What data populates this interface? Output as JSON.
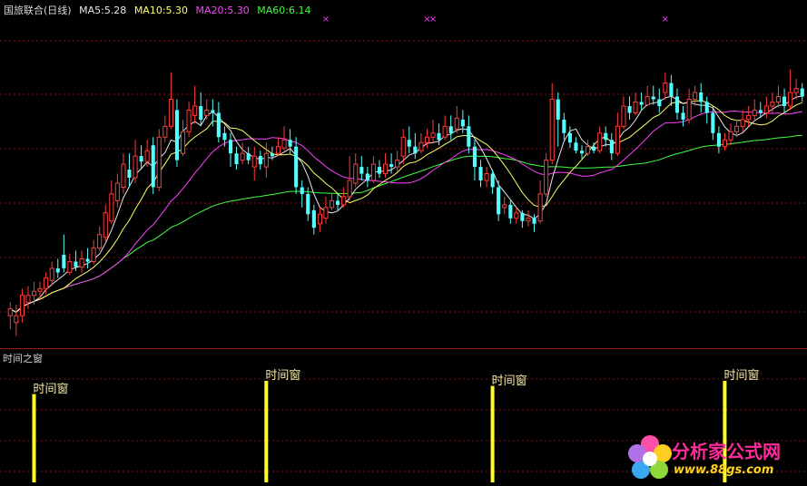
{
  "legend": {
    "title": "国旅联合(日线)",
    "ma5": "MA5:5.28",
    "ma10": "MA10:5.30",
    "ma20": "MA20:5.30",
    "ma60": "MA60:6.14"
  },
  "sub_panel": {
    "title": "时间之窗",
    "marker_label": "时间窗"
  },
  "watermark": {
    "text": "分析家公式网",
    "url": "www.88gs.com"
  },
  "colors": {
    "up": "#ff3b3b",
    "down": "#54ffff",
    "ma5": "#e8e8e8",
    "ma10": "#ffff66",
    "ma20": "#ff40ff",
    "ma60": "#40ff40",
    "grid": "#8a1010",
    "window_bar": "#ffff20",
    "cross_marker": "#ff40ff"
  },
  "chart_data": {
    "type": "candlestick",
    "ylim": [
      4.4,
      6.8
    ],
    "candles": [
      [
        4.6,
        4.65,
        4.7,
        4.5
      ],
      [
        4.55,
        4.6,
        4.68,
        4.45
      ],
      [
        4.6,
        4.75,
        4.8,
        4.55
      ],
      [
        4.7,
        4.75,
        4.82,
        4.65
      ],
      [
        4.75,
        4.78,
        4.85,
        4.68
      ],
      [
        4.78,
        4.8,
        4.85,
        4.72
      ],
      [
        4.8,
        4.88,
        4.92,
        4.76
      ],
      [
        4.86,
        4.95,
        5.0,
        4.82
      ],
      [
        4.95,
        4.92,
        5.02,
        4.88
      ],
      [
        5.05,
        4.95,
        5.2,
        4.92
      ],
      [
        4.92,
        5.0,
        5.06,
        4.9
      ],
      [
        5.0,
        4.96,
        5.08,
        4.93
      ],
      [
        4.96,
        5.02,
        5.08,
        4.92
      ],
      [
        5.02,
        5.0,
        5.1,
        4.95
      ],
      [
        5.0,
        5.1,
        5.16,
        4.98
      ],
      [
        5.1,
        5.2,
        5.26,
        5.08
      ],
      [
        5.18,
        5.36,
        5.42,
        5.15
      ],
      [
        5.3,
        5.5,
        5.6,
        5.28
      ],
      [
        5.45,
        5.58,
        5.65,
        5.4
      ],
      [
        5.55,
        5.72,
        5.8,
        5.5
      ],
      [
        5.68,
        5.62,
        5.8,
        5.55
      ],
      [
        5.62,
        5.78,
        5.9,
        5.58
      ],
      [
        5.78,
        5.74,
        5.86,
        5.68
      ],
      [
        5.74,
        5.82,
        5.9,
        5.7
      ],
      [
        5.86,
        5.55,
        5.92,
        5.5
      ],
      [
        5.55,
        5.92,
        5.98,
        5.52
      ],
      [
        5.92,
        6.0,
        6.08,
        5.88
      ],
      [
        6.0,
        6.2,
        6.4,
        5.98
      ],
      [
        6.12,
        5.75,
        6.2,
        5.7
      ],
      [
        5.8,
        5.96,
        6.05,
        5.78
      ],
      [
        5.96,
        6.12,
        6.18,
        5.92
      ],
      [
        6.08,
        6.15,
        6.3,
        6.02
      ],
      [
        6.15,
        6.05,
        6.25,
        6.0
      ],
      [
        6.08,
        6.12,
        6.2,
        6.05
      ],
      [
        6.12,
        6.1,
        6.2,
        6.0
      ],
      [
        6.1,
        5.92,
        6.18,
        5.88
      ],
      [
        5.95,
        5.9,
        6.0,
        5.85
      ],
      [
        5.9,
        5.8,
        5.95,
        5.7
      ],
      [
        5.8,
        5.72,
        5.85,
        5.68
      ],
      [
        5.75,
        5.8,
        5.88,
        5.72
      ],
      [
        5.8,
        5.75,
        5.85,
        5.72
      ],
      [
        5.7,
        5.78,
        5.85,
        5.6
      ],
      [
        5.78,
        5.72,
        5.82,
        5.68
      ],
      [
        5.7,
        5.8,
        5.88,
        5.62
      ],
      [
        5.8,
        5.78,
        5.85,
        5.75
      ],
      [
        5.8,
        5.85,
        5.92,
        5.78
      ],
      [
        5.84,
        5.9,
        6.0,
        5.82
      ],
      [
        5.9,
        5.85,
        5.98,
        5.8
      ],
      [
        5.85,
        5.55,
        5.92,
        5.5
      ],
      [
        5.55,
        5.5,
        5.6,
        5.4
      ],
      [
        5.5,
        5.35,
        5.55,
        5.3
      ],
      [
        5.38,
        5.25,
        5.42,
        5.2
      ],
      [
        5.28,
        5.35,
        5.4,
        5.22
      ],
      [
        5.32,
        5.4,
        5.48,
        5.28
      ],
      [
        5.4,
        5.45,
        5.5,
        5.38
      ],
      [
        5.45,
        5.42,
        5.5,
        5.38
      ],
      [
        5.42,
        5.48,
        5.55,
        5.4
      ],
      [
        5.48,
        5.6,
        5.78,
        5.45
      ],
      [
        5.58,
        5.72,
        5.8,
        5.55
      ],
      [
        5.7,
        5.65,
        5.78,
        5.6
      ],
      [
        5.65,
        5.6,
        5.7,
        5.55
      ],
      [
        5.6,
        5.72,
        5.78,
        5.58
      ],
      [
        5.7,
        5.65,
        5.75,
        5.62
      ],
      [
        5.65,
        5.72,
        5.8,
        5.62
      ],
      [
        5.72,
        5.7,
        5.8,
        5.65
      ],
      [
        5.7,
        5.75,
        5.82,
        5.66
      ],
      [
        5.78,
        5.92,
        5.98,
        5.72
      ],
      [
        5.9,
        5.85,
        6.0,
        5.8
      ],
      [
        5.85,
        5.8,
        5.95,
        5.76
      ],
      [
        5.82,
        5.88,
        5.95,
        5.8
      ],
      [
        5.88,
        5.92,
        5.98,
        5.84
      ],
      [
        5.92,
        5.95,
        6.05,
        5.88
      ],
      [
        5.95,
        5.9,
        6.02,
        5.86
      ],
      [
        5.92,
        6.0,
        6.08,
        5.9
      ],
      [
        6.0,
        5.95,
        6.08,
        5.9
      ],
      [
        5.98,
        6.06,
        6.15,
        5.95
      ],
      [
        6.05,
        6.0,
        6.12,
        5.95
      ],
      [
        6.0,
        5.85,
        6.08,
        5.8
      ],
      [
        5.85,
        5.7,
        5.9,
        5.6
      ],
      [
        5.7,
        5.6,
        5.75,
        5.55
      ],
      [
        5.6,
        5.65,
        5.7,
        5.55
      ],
      [
        5.65,
        5.55,
        5.68,
        5.5
      ],
      [
        5.55,
        5.35,
        5.6,
        5.3
      ],
      [
        5.4,
        5.42,
        5.48,
        5.35
      ],
      [
        5.42,
        5.32,
        5.45,
        5.28
      ],
      [
        5.32,
        5.36,
        5.4,
        5.28
      ],
      [
        5.36,
        5.3,
        5.38,
        5.25
      ],
      [
        5.3,
        5.32,
        5.38,
        5.26
      ],
      [
        5.32,
        5.28,
        5.35,
        5.22
      ],
      [
        5.3,
        5.5,
        5.6,
        5.28
      ],
      [
        5.5,
        5.75,
        5.8,
        5.48
      ],
      [
        5.75,
        6.2,
        6.32,
        5.72
      ],
      [
        6.2,
        6.05,
        6.25,
        5.85
      ],
      [
        6.05,
        5.95,
        6.1,
        5.9
      ],
      [
        5.95,
        5.88,
        6.0,
        5.84
      ],
      [
        5.88,
        5.82,
        5.92,
        5.8
      ],
      [
        5.82,
        5.8,
        5.86,
        5.76
      ],
      [
        5.8,
        5.85,
        5.9,
        5.78
      ],
      [
        5.85,
        5.82,
        5.88,
        5.8
      ],
      [
        5.82,
        5.95,
        6.0,
        5.8
      ],
      [
        5.95,
        5.9,
        6.0,
        5.85
      ],
      [
        5.9,
        5.8,
        5.95,
        5.75
      ],
      [
        5.8,
        6.0,
        6.1,
        5.78
      ],
      [
        6.0,
        6.15,
        6.22,
        5.98
      ],
      [
        6.15,
        6.1,
        6.22,
        6.05
      ],
      [
        6.1,
        6.18,
        6.25,
        6.08
      ],
      [
        6.18,
        6.16,
        6.25,
        6.12
      ],
      [
        6.16,
        6.22,
        6.3,
        6.15
      ],
      [
        6.22,
        6.2,
        6.3,
        6.16
      ],
      [
        6.2,
        6.15,
        6.28,
        6.1
      ],
      [
        6.25,
        6.32,
        6.4,
        6.2
      ],
      [
        6.32,
        6.22,
        6.38,
        6.15
      ],
      [
        6.22,
        6.1,
        6.28,
        6.05
      ],
      [
        6.1,
        6.05,
        6.15,
        6.0
      ],
      [
        6.05,
        6.2,
        6.28,
        6.02
      ],
      [
        6.2,
        6.25,
        6.3,
        6.15
      ],
      [
        6.25,
        6.18,
        6.32,
        6.1
      ],
      [
        6.18,
        6.1,
        6.22,
        6.02
      ],
      [
        6.1,
        5.95,
        6.15,
        5.9
      ],
      [
        5.95,
        5.85,
        6.0,
        5.8
      ],
      [
        5.85,
        5.9,
        5.95,
        5.82
      ],
      [
        5.9,
        5.96,
        6.02,
        5.86
      ],
      [
        5.96,
        6.0,
        6.05,
        5.92
      ],
      [
        6.0,
        6.05,
        6.12,
        5.96
      ],
      [
        6.05,
        6.08,
        6.15,
        6.0
      ],
      [
        6.08,
        6.12,
        6.2,
        6.04
      ],
      [
        6.12,
        6.1,
        6.18,
        6.06
      ],
      [
        6.1,
        6.15,
        6.22,
        6.06
      ],
      [
        6.15,
        6.18,
        6.25,
        6.1
      ],
      [
        6.18,
        6.22,
        6.3,
        6.14
      ],
      [
        6.22,
        6.15,
        6.28,
        6.1
      ],
      [
        6.15,
        6.25,
        6.42,
        6.12
      ],
      [
        6.25,
        6.28,
        6.35,
        6.2
      ],
      [
        6.28,
        6.22,
        6.32,
        6.18
      ]
    ],
    "cross_marker_days": [
      53,
      70,
      71,
      110
    ],
    "window_days": [
      4,
      43,
      81,
      120
    ],
    "window_values": [
      0.87,
      1.0,
      0.95,
      1.0
    ]
  }
}
